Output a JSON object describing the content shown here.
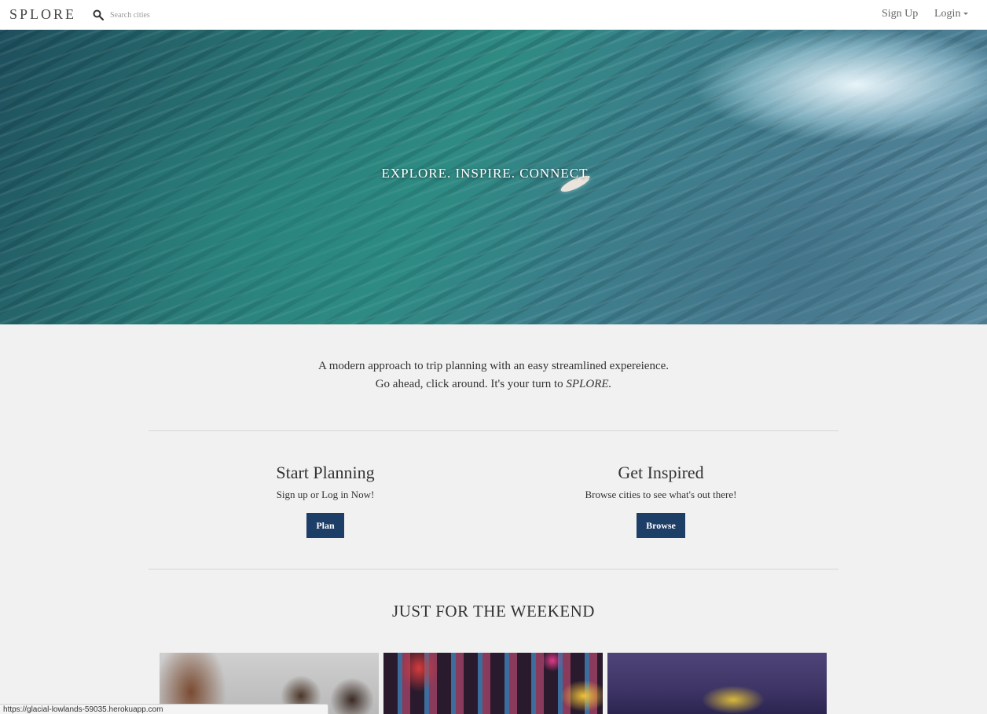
{
  "navbar": {
    "brand": "SPLORE",
    "search_placeholder": "Search cities",
    "signup_label": "Sign Up",
    "login_label": "Login"
  },
  "hero": {
    "tagline": "EXPLORE. INSPIRE. CONNECT."
  },
  "intro": {
    "line1": "A modern approach to trip planning with an easy streamlined expereience.",
    "line2_prefix": "Go ahead, click around. It's your turn to ",
    "line2_brand": "SPLORE."
  },
  "plan": {
    "title": "Start Planning",
    "subtitle": "Sign up or Log in Now!",
    "button": "Plan"
  },
  "browse": {
    "title": "Get Inspired",
    "subtitle": "Browse cities to see what's out there!",
    "button": "Browse"
  },
  "weekend": {
    "title": "JUST FOR THE WEEKEND"
  },
  "status_bar": {
    "url": "https://glacial-lowlands-59035.herokuapp.com"
  },
  "colors": {
    "primary_button": "#1d3e66",
    "page_background": "#f1f1f1"
  }
}
